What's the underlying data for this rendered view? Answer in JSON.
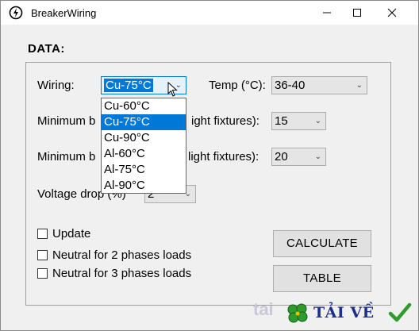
{
  "window": {
    "title": "BreakerWiring"
  },
  "section": {
    "label": "DATA:"
  },
  "form": {
    "wiring_label": "Wiring:",
    "wiring_value": "Cu-75°C",
    "wiring_options": [
      "Cu-60°C",
      "Cu-75°C",
      "Cu-90°C",
      "Al-60°C",
      "Al-75°C",
      "Al-90°C"
    ],
    "temp_label": "Temp (°C):",
    "temp_value": "36-40",
    "min_breaker_1_label_start": "Minimum b",
    "min_breaker_1_label_end": "ight fixtures):",
    "min_breaker_1_value": "15",
    "min_breaker_2_label_start": "Minimum b",
    "min_breaker_2_label_end": "light fixtures):",
    "min_breaker_2_value": "20",
    "voltage_drop_label": "Voltage drop (%)",
    "voltage_drop_value": "2"
  },
  "checkboxes": {
    "update": "Update",
    "neutral_2": "Neutral for 2 phases loads",
    "neutral_3": "Neutral for 3 phases loads"
  },
  "buttons": {
    "calculate": "CALCULATE",
    "table": "TABLE"
  },
  "watermark": {
    "faded": "tai",
    "text": "TẢI VỀ"
  },
  "colors": {
    "selection": "#0078d7",
    "watermark_text": "#1e2f8a",
    "watermark_green": "#2e9b2e"
  }
}
